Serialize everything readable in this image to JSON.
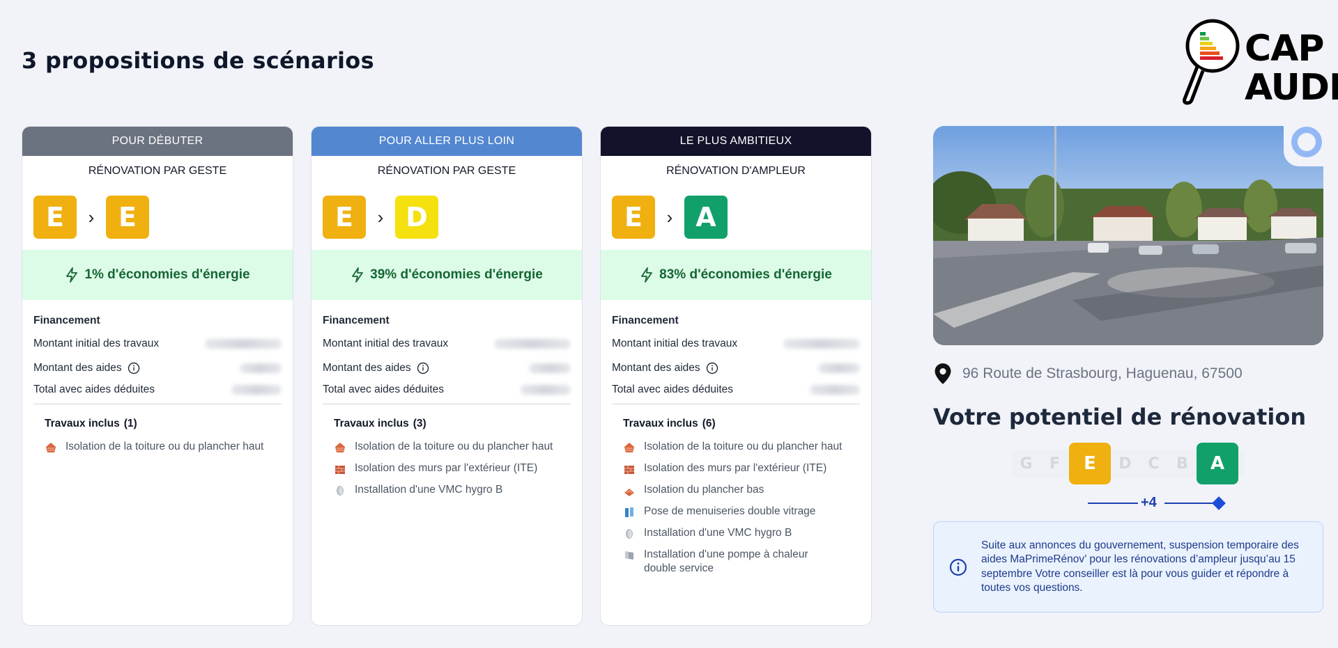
{
  "page": {
    "title": "3 propositions de scénarios"
  },
  "logo": {
    "line1": "CAP",
    "line2": "AUDIT"
  },
  "colors": {
    "grade_E": "#efb010",
    "grade_D": "#f4e10f",
    "grade_A": "#12a06a",
    "savings_bg": "#dcfce7",
    "savings_text": "#166534"
  },
  "cards": [
    {
      "header": "POUR DÉBUTER",
      "header_color": "#6b7280",
      "subtitle": "RÉNOVATION PAR GESTE",
      "from_grade": "E",
      "to_grade": "E",
      "savings": "1% d'économies d'énergie",
      "financement": {
        "title": "Financement",
        "initial_label": "Montant initial des travaux",
        "aides_label": "Montant des aides",
        "total_label": "Total avec aides déduites"
      },
      "works_title": "Travaux inclus",
      "works_count": "(1)",
      "works": [
        {
          "icon": "roof-insulation-icon",
          "label": "Isolation de la toiture ou du plancher haut"
        }
      ]
    },
    {
      "header": "POUR ALLER PLUS LOIN",
      "header_color": "#5387d0",
      "subtitle": "RÉNOVATION PAR GESTE",
      "from_grade": "E",
      "to_grade": "D",
      "savings": "39% d'économies d'énergie",
      "financement": {
        "title": "Financement",
        "initial_label": "Montant initial des travaux",
        "aides_label": "Montant des aides",
        "total_label": "Total avec aides déduites"
      },
      "works_title": "Travaux inclus",
      "works_count": "(3)",
      "works": [
        {
          "icon": "roof-insulation-icon",
          "label": "Isolation de la toiture ou du plancher haut"
        },
        {
          "icon": "wall-insulation-icon",
          "label": "Isolation des murs par l'extérieur (ITE)"
        },
        {
          "icon": "vmc-icon",
          "label": "Installation d'une VMC hygro B"
        }
      ]
    },
    {
      "header": "LE PLUS AMBITIEUX",
      "header_color": "#12122a",
      "subtitle": "RÉNOVATION D'AMPLEUR",
      "from_grade": "E",
      "to_grade": "A",
      "savings": "83% d'économies d'énergie",
      "financement": {
        "title": "Financement",
        "initial_label": "Montant initial des travaux",
        "aides_label": "Montant des aides",
        "total_label": "Total avec aides déduites"
      },
      "works_title": "Travaux inclus",
      "works_count": "(6)",
      "works": [
        {
          "icon": "roof-insulation-icon",
          "label": "Isolation de la toiture ou du plancher haut"
        },
        {
          "icon": "wall-insulation-icon",
          "label": "Isolation des murs par l'extérieur (ITE)"
        },
        {
          "icon": "floor-insulation-icon",
          "label": "Isolation du plancher bas"
        },
        {
          "icon": "window-icon",
          "label": "Pose de menuiseries double vitrage"
        },
        {
          "icon": "vmc-icon",
          "label": "Installation d'une VMC hygro B"
        },
        {
          "icon": "heat-pump-icon",
          "label": "Installation d'une pompe à chaleur double service"
        }
      ]
    }
  ],
  "property": {
    "address": "96 Route de Strasbourg, Haguenau, 67500",
    "potential_title": "Votre potentiel de rénovation",
    "scale": [
      "G",
      "F",
      "E",
      "D",
      "C",
      "B",
      "A"
    ],
    "current_grade": "E",
    "target_grade": "A",
    "gain": "+4"
  },
  "notice": {
    "icon": "info-icon",
    "text": "Suite aux annonces du gouvernement, suspension temporaire des aides MaPrimeRénov’ pour les rénovations d’ampleur jusqu’au 15 septembre Votre conseiller est là pour vous guider et répondre à toutes vos questions."
  }
}
